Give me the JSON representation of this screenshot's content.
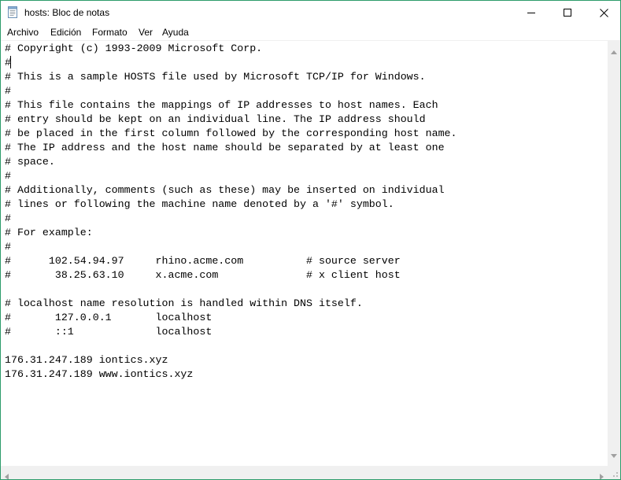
{
  "window": {
    "title": "hosts: Bloc de notas",
    "icons": {
      "app": "notepad-icon",
      "minimize": "minimize-icon",
      "maximize": "maximize-icon",
      "close": "close-icon"
    }
  },
  "menu": {
    "items": [
      "Archivo",
      "Edición",
      "Formato",
      "Ver",
      "Ayuda"
    ]
  },
  "editor": {
    "content": "# Copyright (c) 1993-2009 Microsoft Corp.\n#\n# This is a sample HOSTS file used by Microsoft TCP/IP for Windows.\n#\n# This file contains the mappings of IP addresses to host names. Each\n# entry should be kept on an individual line. The IP address should\n# be placed in the first column followed by the corresponding host name.\n# The IP address and the host name should be separated by at least one\n# space.\n#\n# Additionally, comments (such as these) may be inserted on individual\n# lines or following the machine name denoted by a '#' symbol.\n#\n# For example:\n#\n#      102.54.94.97     rhino.acme.com          # source server\n#       38.25.63.10     x.acme.com              # x client host\n\n# localhost name resolution is handled within DNS itself.\n#\t127.0.0.1       localhost\n#\t::1             localhost\n\n176.31.247.189 iontics.xyz\n176.31.247.189 www.iontics.xyz"
  },
  "scrollbars": {
    "icons": {
      "up": "scroll-up-arrow-icon",
      "down": "scroll-down-arrow-icon",
      "left": "scroll-left-arrow-icon",
      "right": "scroll-right-arrow-icon"
    }
  }
}
